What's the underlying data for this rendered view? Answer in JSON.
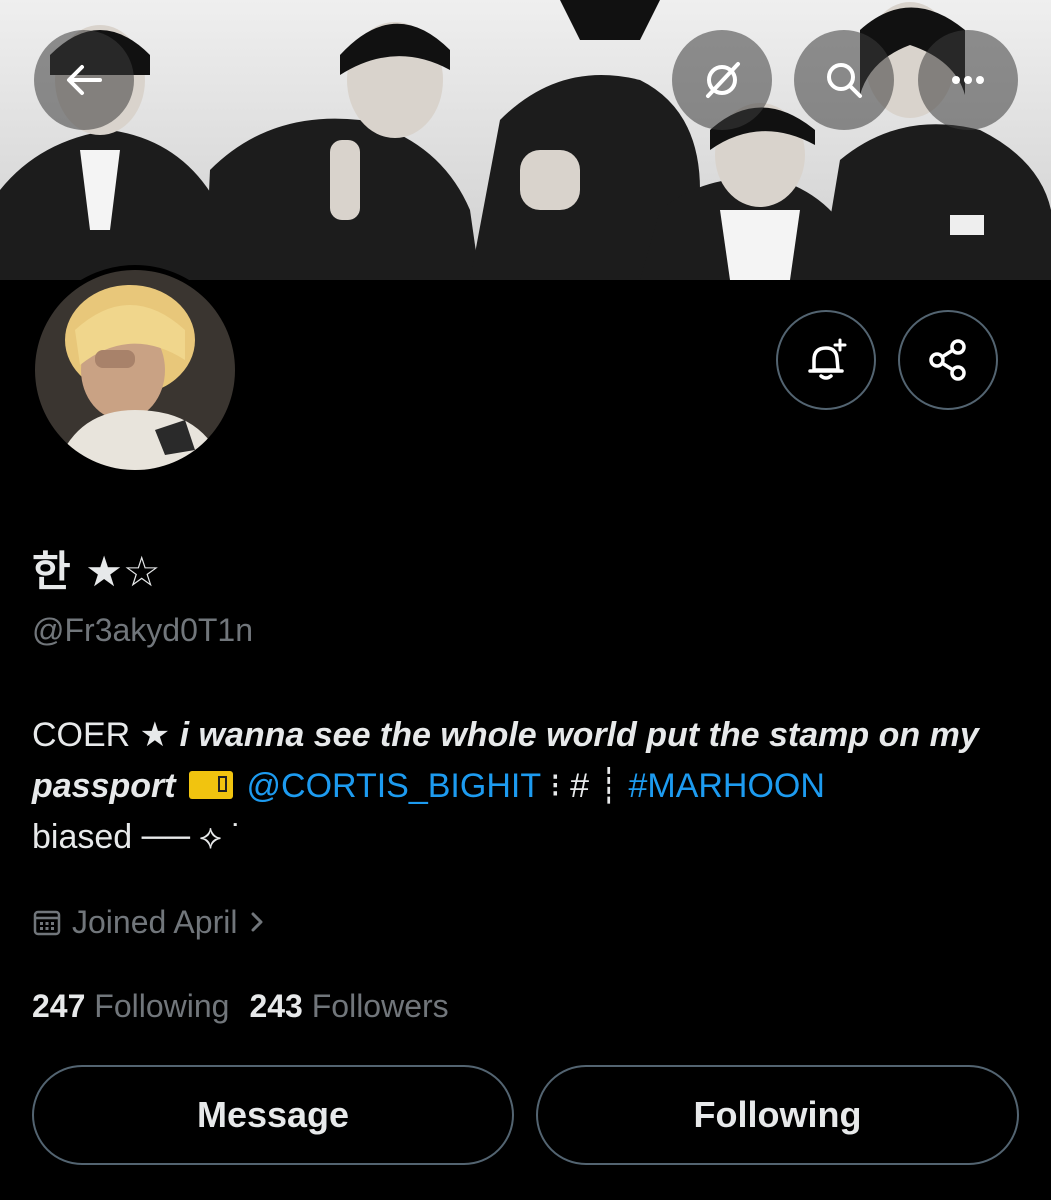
{
  "banner": {
    "description_icon": "group-photo"
  },
  "header": {
    "back_icon": "arrow-left-icon",
    "grok_icon": "grok-icon",
    "search_icon": "search-icon",
    "more_icon": "more-icon"
  },
  "profile": {
    "display_name": "한 ★☆",
    "handle": "@Fr3akyd0T1n",
    "bio": {
      "part1": "COER ★ ",
      "part2_italic": "i wanna see the whole world put the stamp on my passport",
      "mention": "@CORTIS_BIGHIT",
      "sep": " ⁝ # ┊",
      "hashtag": "#MARHOON",
      "tail": "biased ── ⟡ ˙"
    },
    "joined": "Joined April",
    "following_count": "247",
    "following_label": "Following",
    "followers_count": "243",
    "followers_label": "Followers"
  },
  "actions": {
    "message_label": "Message",
    "following_label": "Following"
  },
  "colors": {
    "accent": "#1d9bf0",
    "muted": "#71767b",
    "border": "#536471"
  }
}
